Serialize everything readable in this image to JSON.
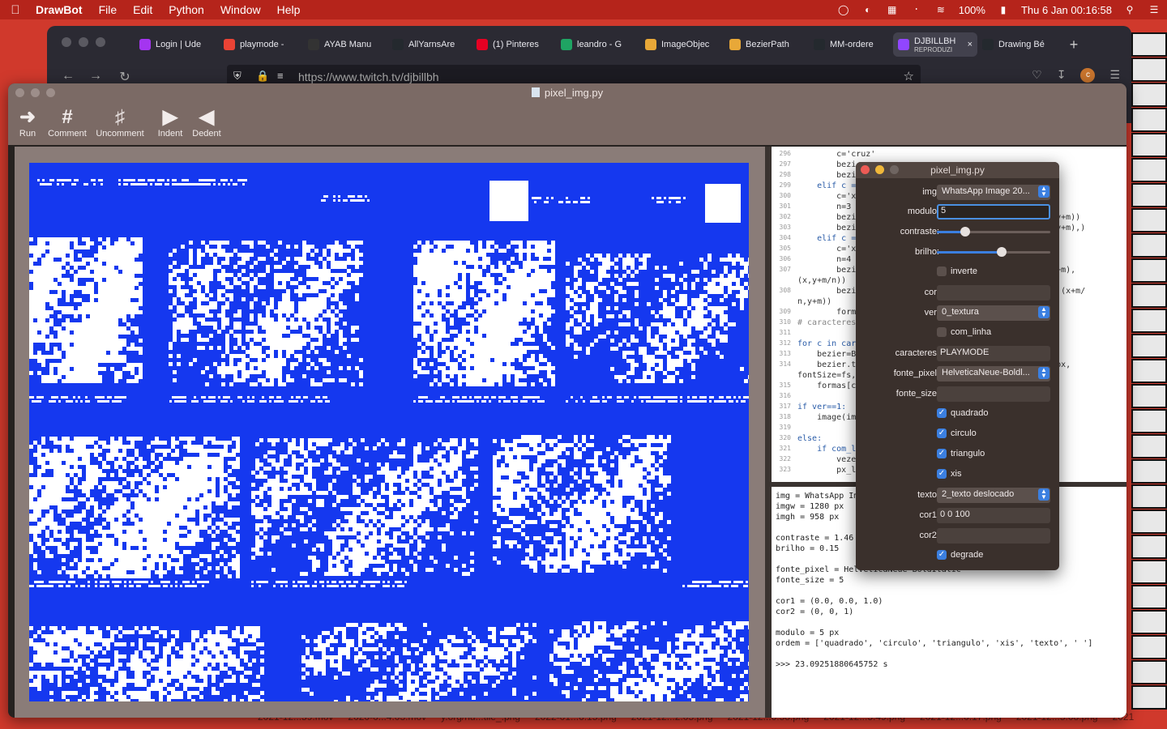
{
  "menubar": {
    "app": "DrawBot",
    "items": [
      "File",
      "Edit",
      "Python",
      "Window",
      "Help"
    ],
    "battery": "100%",
    "datetime": "Thu 6 Jan  00:16:58"
  },
  "browser": {
    "tabs": [
      {
        "label": "Login | Ude",
        "icon": "udemy-icon",
        "color": "#a435f0"
      },
      {
        "label": "playmode -",
        "icon": "gmail-icon",
        "color": "#ea4335"
      },
      {
        "label": "AYAB Manu",
        "icon": "book-icon",
        "color": "#333333"
      },
      {
        "label": "AllYarnsAre",
        "icon": "github-icon",
        "color": "#24292e"
      },
      {
        "label": "(1) Pinteres",
        "icon": "pinterest-icon",
        "color": "#e60023"
      },
      {
        "label": "leandro - G",
        "icon": "drive-icon",
        "color": "#1fa463"
      },
      {
        "label": "ImageObjec",
        "icon": "drawbot-icon",
        "color": "#e8a838"
      },
      {
        "label": "BezierPath",
        "icon": "drawbot-icon",
        "color": "#e8a838"
      },
      {
        "label": "MM-ordere",
        "icon": "github-icon",
        "color": "#24292e"
      },
      {
        "label": "DJBILLBH",
        "sub": "REPRODUZI",
        "icon": "twitch-icon",
        "color": "#9146ff",
        "active": true
      },
      {
        "label": "Drawing Bé",
        "icon": "github-icon",
        "color": "#24292e"
      }
    ],
    "url": "https://www.twitch.tv/djbillbh"
  },
  "window": {
    "title": "pixel_img.py",
    "toolbar": [
      "Run",
      "Comment",
      "Uncomment",
      "Indent",
      "Dedent"
    ]
  },
  "code": [
    {
      "n": "296",
      "t": "        c='cruz'"
    },
    {
      "n": "297",
      "t": "        bezi"
    },
    {
      "n": "298",
      "t": "        bezi"
    },
    {
      "n": "299",
      "t": "    elif c ="
    },
    {
      "n": "300",
      "t": "        c='x"
    },
    {
      "n": "301",
      "t": "        n=3"
    },
    {
      "n": "302",
      "t": "        bezi                                     m/n,y+m))"
    },
    {
      "n": "303",
      "t": "        bezi                                     ,(x,y+m),)"
    },
    {
      "n": "304",
      "t": "    elif c ="
    },
    {
      "n": "305",
      "t": "        c='x"
    },
    {
      "n": "306",
      "t": "        n=4"
    },
    {
      "n": "307",
      "t": "        bezi                                     (m,y+m),"
    },
    {
      "n": "",
      "t": "(x,y+m/n))"
    },
    {
      "n": "308",
      "t": "        bezi                                     m/n),(x+m/"
    },
    {
      "n": "",
      "t": "n,y+m))"
    },
    {
      "n": "309",
      "t": "        formas[c"
    },
    {
      "n": "310",
      "t": "# caracteres"
    },
    {
      "n": "311",
      "t": ""
    },
    {
      "n": "312",
      "t": "for c in car"
    },
    {
      "n": "313",
      "t": "    bezier=B"
    },
    {
      "n": "314",
      "t": "    bezier.t                                     nte_px,"
    },
    {
      "n": "",
      "t": "fontSize=fs,"
    },
    {
      "n": "315",
      "t": "    formas[c"
    },
    {
      "n": "316",
      "t": ""
    },
    {
      "n": "317",
      "t": "if ver==1:"
    },
    {
      "n": "318",
      "t": "    image(im"
    },
    {
      "n": "319",
      "t": ""
    },
    {
      "n": "320",
      "t": "else:"
    },
    {
      "n": "321",
      "t": "    if com_l"
    },
    {
      "n": "322",
      "t": "        veze"
    },
    {
      "n": "323",
      "t": "        px_l"
    }
  ],
  "output": [
    "img = WhatsApp Im",
    "imgw = 1280 px",
    "imgh = 958 px",
    "",
    "contraste = 1.46",
    "brilho = 0.15",
    "",
    "fonte_pixel = HelveticaNeue-BoldItalic",
    "fonte_size = 5",
    "",
    "cor1 = (0.0, 0.0, 1.0)",
    "cor2 = (0, 0, 1)",
    "",
    "modulo = 5 px",
    "ordem = ['quadrado', 'circulo', 'triangulo', 'xis', 'texto', ' ']",
    "",
    ">>> 23.09251880645752 s"
  ],
  "panel": {
    "title": "pixel_img.py",
    "img_label": "img:",
    "img_value": "WhatsApp Image 20...",
    "modulo_label": "modulo:",
    "modulo_value": "5",
    "contraste_label": "contraste:",
    "contraste_value": 0.25,
    "brilho_label": "brilho:",
    "brilho_value": 0.57,
    "inverte_label": "inverte",
    "inverte": false,
    "cor_label": "cor:",
    "cor_value": "",
    "ver_label": "ver:",
    "ver_value": "0_textura",
    "com_linha_label": "com_linha",
    "com_linha": false,
    "caracteres_label": "caracteres:",
    "caracteres_value": "PLAYMODE",
    "fonte_pixel_label": "fonte_pixel:",
    "fonte_pixel_value": "HelveticaNeue-Boldl...",
    "fonte_size_label": "fonte_size:",
    "fonte_size_value": "",
    "quadrado_label": "quadrado",
    "quadrado": true,
    "circulo_label": "circulo",
    "circulo": true,
    "triangulo_label": "triangulo",
    "triangulo": true,
    "xis_label": "xis",
    "xis": true,
    "texto_label": "texto:",
    "texto_value": "2_texto deslocado",
    "cor1_label": "cor1:",
    "cor1_value": "0 0 100",
    "cor2_label": "cor2:",
    "cor2_value": "",
    "degrade_label": "degrade",
    "degrade": true
  },
  "desktop_files": [
    "2021-12...59.mov",
    "2020-0...4.03.mov",
    "y.org/hu...tile_.png",
    "2022-01...6.15.png",
    "2021-12...2.05.png",
    "2021-12...6.58.png",
    "2021-12...5.49.png",
    "2021-12...0.17.png",
    "2021-12...5.08.png",
    "2021"
  ],
  "colors": {
    "canvas_blue": "#1538ef",
    "accent": "#3b7fe0",
    "menubar": "#b5241b"
  }
}
